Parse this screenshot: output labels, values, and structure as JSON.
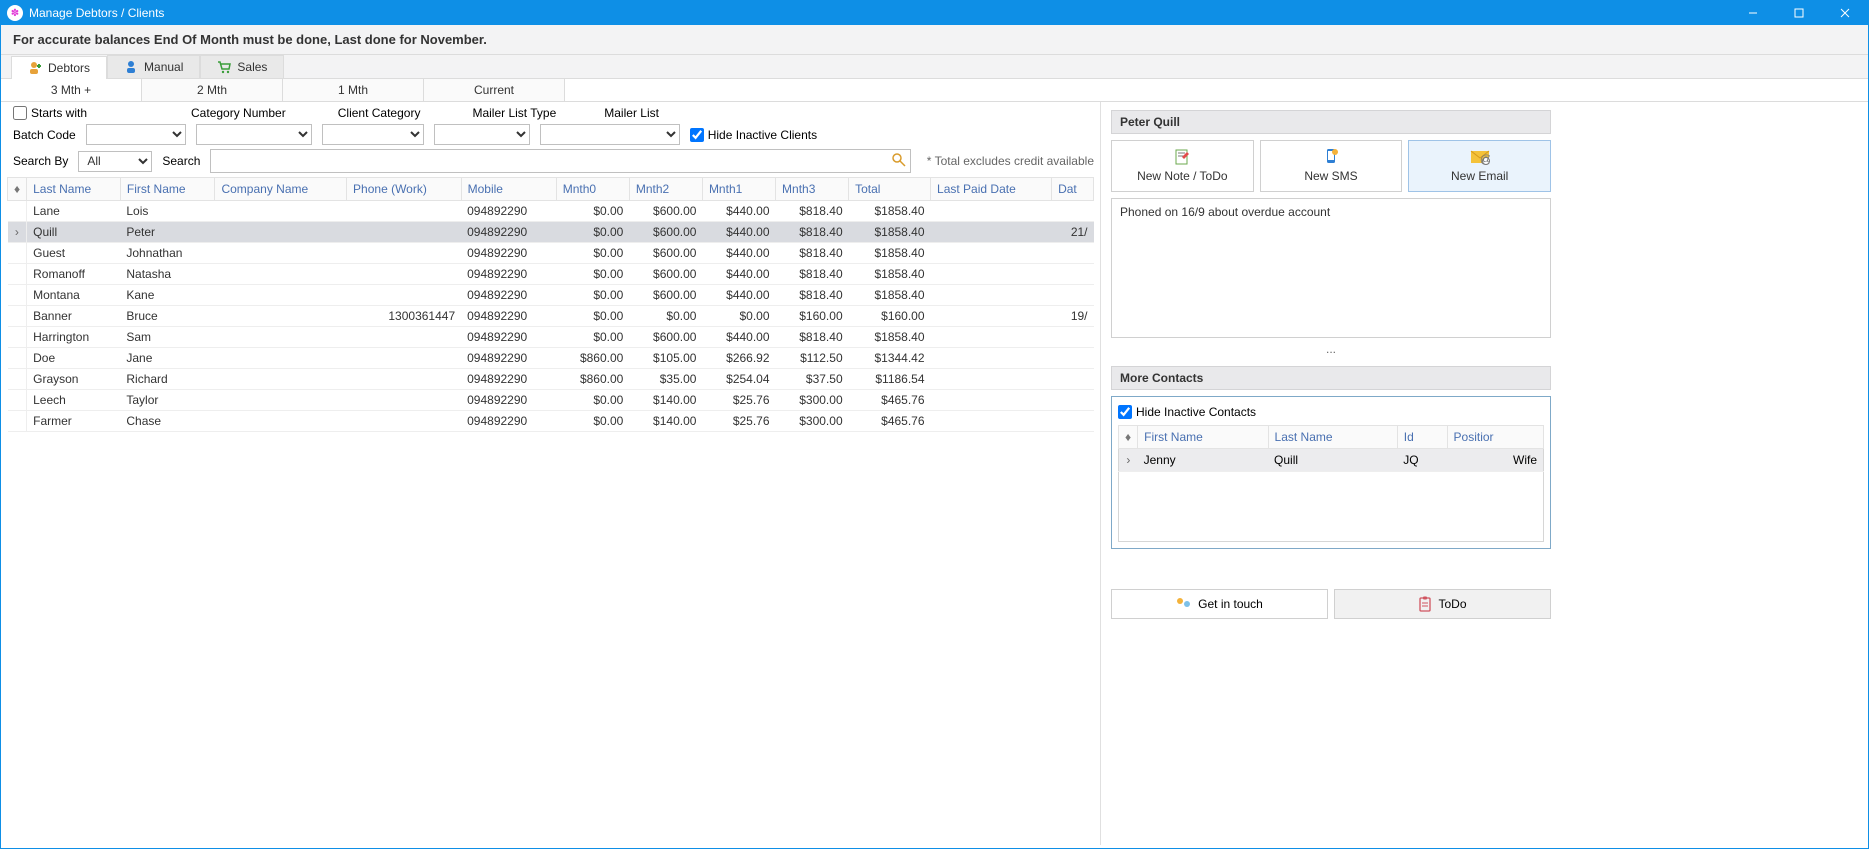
{
  "window": {
    "title": "Manage Debtors / Clients"
  },
  "subheader": "For accurate balances End Of Month must be done, Last done for November.",
  "mainTabs": [
    {
      "label": "Debtors",
      "icon": "person-add",
      "active": true
    },
    {
      "label": "Manual",
      "icon": "person-gear",
      "active": false
    },
    {
      "label": "Sales",
      "icon": "cart",
      "active": false
    }
  ],
  "subTabs": [
    {
      "label": "3 Mth +",
      "active": true
    },
    {
      "label": "2 Mth",
      "active": false
    },
    {
      "label": "1 Mth",
      "active": false
    },
    {
      "label": "Current",
      "active": false
    }
  ],
  "filters": {
    "starts_with_label": "Starts with",
    "batch_code_label": "Batch Code",
    "category_number_label": "Category Number",
    "client_category_label": "Client Category",
    "mailer_list_type_label": "Mailer List Type",
    "mailer_list_label": "Mailer List",
    "hide_inactive_label": "Hide Inactive Clients",
    "search_by_label": "Search By",
    "search_by_value": "All",
    "search_label": "Search",
    "footnote": "* Total excludes credit available"
  },
  "grid": {
    "columns": [
      "Last Name",
      "First Name",
      "Company Name",
      "Phone (Work)",
      "Mobile",
      "Mnth0",
      "Mnth2",
      "Mnth1",
      "Mnth3",
      "Total",
      "Last Paid Date",
      "Dat"
    ],
    "rows": [
      {
        "last": "Lane",
        "first": "Lois",
        "company": "",
        "phone": "",
        "mobile": "094892290",
        "m0": "$0.00",
        "m2": "$600.00",
        "m1": "$440.00",
        "m3": "$818.40",
        "total": "$1858.40",
        "lpd": "",
        "dat": ""
      },
      {
        "last": "Quill",
        "first": "Peter",
        "company": "",
        "phone": "",
        "mobile": "094892290",
        "m0": "$0.00",
        "m2": "$600.00",
        "m1": "$440.00",
        "m3": "$818.40",
        "total": "$1858.40",
        "lpd": "",
        "dat": "21/",
        "selected": true
      },
      {
        "last": "Guest",
        "first": "Johnathan",
        "company": "",
        "phone": "",
        "mobile": "094892290",
        "m0": "$0.00",
        "m2": "$600.00",
        "m1": "$440.00",
        "m3": "$818.40",
        "total": "$1858.40",
        "lpd": "",
        "dat": ""
      },
      {
        "last": "Romanoff",
        "first": "Natasha",
        "company": "",
        "phone": "",
        "mobile": "094892290",
        "m0": "$0.00",
        "m2": "$600.00",
        "m1": "$440.00",
        "m3": "$818.40",
        "total": "$1858.40",
        "lpd": "",
        "dat": ""
      },
      {
        "last": "Montana",
        "first": "Kane",
        "company": "",
        "phone": "",
        "mobile": "094892290",
        "m0": "$0.00",
        "m2": "$600.00",
        "m1": "$440.00",
        "m3": "$818.40",
        "total": "$1858.40",
        "lpd": "",
        "dat": ""
      },
      {
        "last": "Banner",
        "first": "Bruce",
        "company": "",
        "phone": "1300361447",
        "mobile": "094892290",
        "m0": "$0.00",
        "m2": "$0.00",
        "m1": "$0.00",
        "m3": "$160.00",
        "total": "$160.00",
        "lpd": "",
        "dat": "19/"
      },
      {
        "last": "Harrington",
        "first": "Sam",
        "company": "",
        "phone": "",
        "mobile": "094892290",
        "m0": "$0.00",
        "m2": "$600.00",
        "m1": "$440.00",
        "m3": "$818.40",
        "total": "$1858.40",
        "lpd": "",
        "dat": ""
      },
      {
        "last": "Doe",
        "first": "Jane",
        "company": "",
        "phone": "",
        "mobile": "094892290",
        "m0": "$860.00",
        "m2": "$105.00",
        "m1": "$266.92",
        "m3": "$112.50",
        "total": "$1344.42",
        "lpd": "",
        "dat": ""
      },
      {
        "last": "Grayson",
        "first": "Richard",
        "company": "",
        "phone": "",
        "mobile": "094892290",
        "m0": "$860.00",
        "m2": "$35.00",
        "m1": "$254.04",
        "m3": "$37.50",
        "total": "$1186.54",
        "lpd": "",
        "dat": ""
      },
      {
        "last": "Leech",
        "first": "Taylor",
        "company": "",
        "phone": "",
        "mobile": "094892290",
        "m0": "$0.00",
        "m2": "$140.00",
        "m1": "$25.76",
        "m3": "$300.00",
        "total": "$465.76",
        "lpd": "",
        "dat": ""
      },
      {
        "last": "Farmer",
        "first": "Chase",
        "company": "",
        "phone": "",
        "mobile": "094892290",
        "m0": "$0.00",
        "m2": "$140.00",
        "m1": "$25.76",
        "m3": "$300.00",
        "total": "$465.76",
        "lpd": "",
        "dat": ""
      }
    ]
  },
  "right": {
    "client_name": "Peter Quill",
    "cards": {
      "note_label": "New Note / ToDo",
      "sms_label": "New SMS",
      "email_label": "New Email"
    },
    "notes_text": "Phoned on 16/9 about overdue account",
    "ellipsis": "...",
    "more_contacts_title": "More Contacts",
    "hide_inactive_contacts_label": "Hide Inactive Contacts",
    "contacts_columns": [
      "First Name",
      "Last Name",
      "Id",
      "Positior"
    ],
    "contacts_rows": [
      {
        "first": "Jenny",
        "last": "Quill",
        "id": "JQ",
        "pos": "Wife"
      }
    ],
    "get_in_touch_label": "Get in touch",
    "todo_label": "ToDo"
  }
}
